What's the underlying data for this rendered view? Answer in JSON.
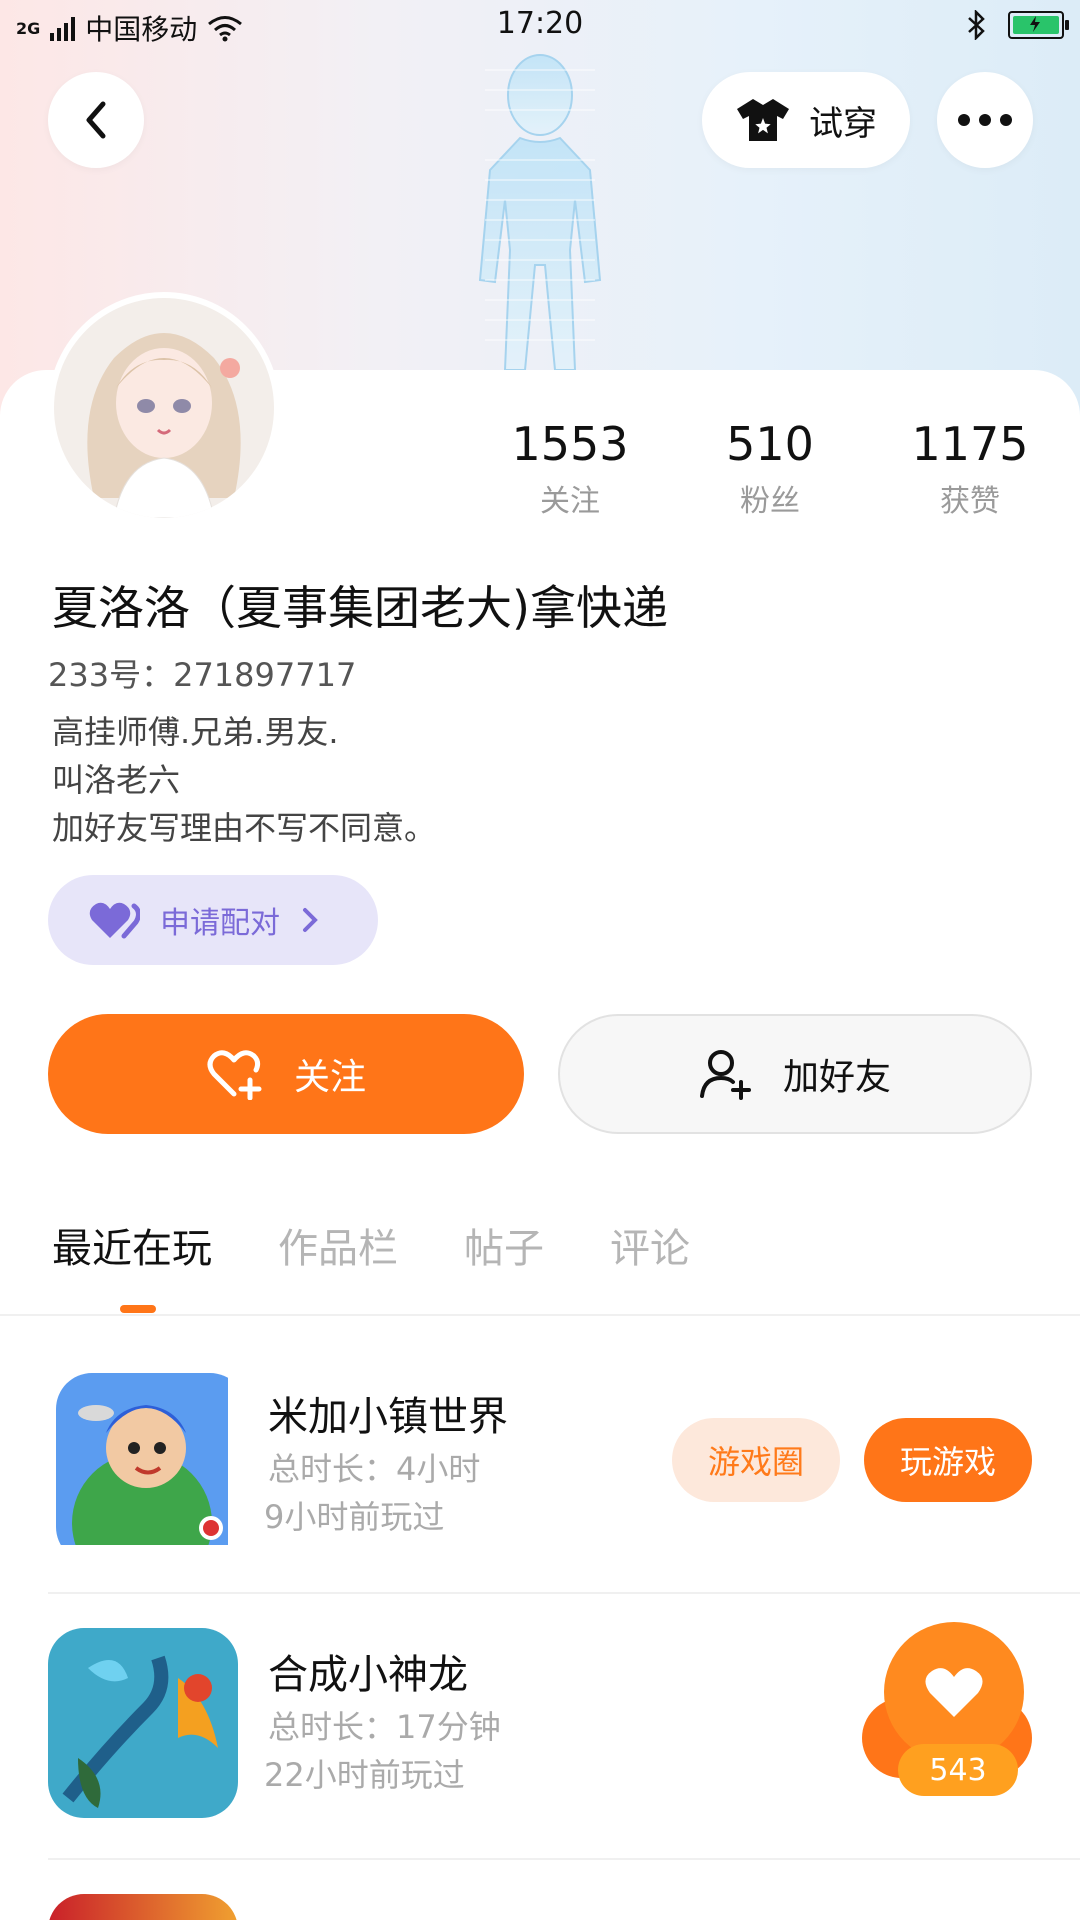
{
  "status_bar": {
    "network": "2G",
    "carrier": "中国移动",
    "time": "17:20"
  },
  "header": {
    "try_on_label": "试穿"
  },
  "profile": {
    "nickname": "夏洛洛（夏事集团老大)拿快递",
    "uid_line": "233号：271897717",
    "bio": [
      "高挂师傅.兄弟.男友.",
      "叫洛老六",
      "加好友写理由不写不同意。"
    ],
    "stats": [
      {
        "value": "1553",
        "label": "关注"
      },
      {
        "value": "510",
        "label": "粉丝"
      },
      {
        "value": "1175",
        "label": "获赞"
      }
    ]
  },
  "pair_button": {
    "label": "申请配对"
  },
  "actions": {
    "follow_label": "关注",
    "add_friend_label": "加好友"
  },
  "tabs": [
    {
      "label": "最近在玩",
      "active": true
    },
    {
      "label": "作品栏",
      "active": false
    },
    {
      "label": "帖子",
      "active": false
    },
    {
      "label": "评论",
      "active": false
    }
  ],
  "games": [
    {
      "name": "米加小镇世界",
      "duration": "总时长：4小时",
      "last_played": "9小时前玩过",
      "circle_label": "游戏圈",
      "play_label": "玩游戏"
    },
    {
      "name": "合成小神龙",
      "duration": "总时长：17分钟",
      "last_played": "22小时前玩过"
    }
  ],
  "like_float": {
    "count": "543"
  },
  "colors": {
    "accent_orange": "#ff7518",
    "pair_purple": "#7b6ad8",
    "pair_bg": "#e7e5f9"
  }
}
